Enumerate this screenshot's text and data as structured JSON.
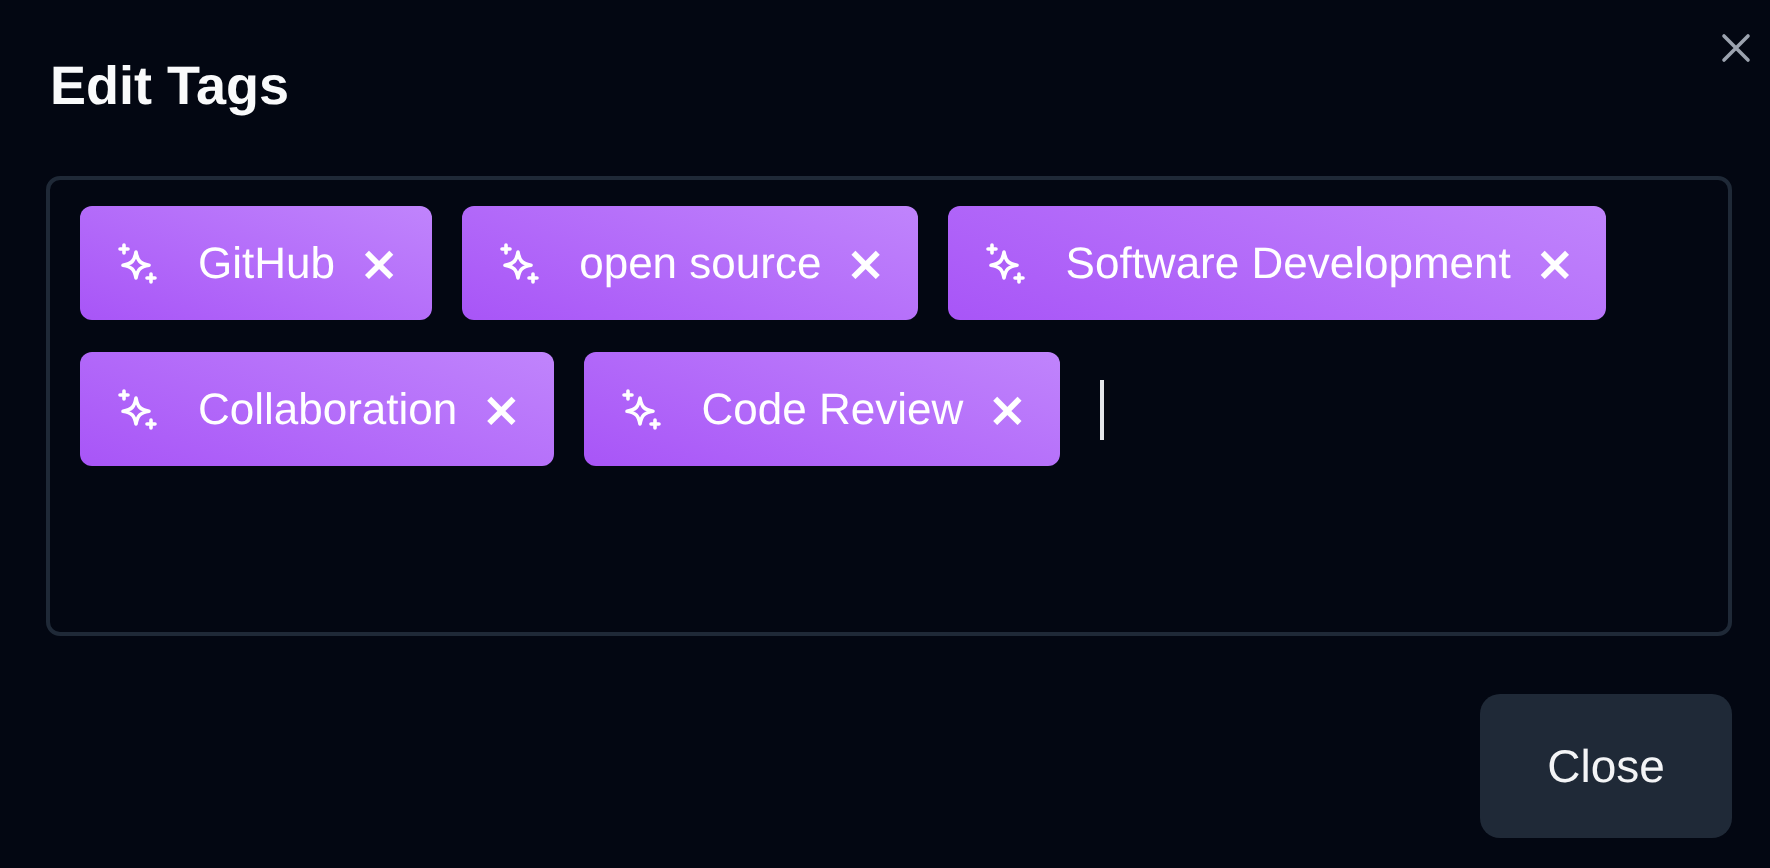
{
  "dialog": {
    "title": "Edit Tags"
  },
  "tags": [
    {
      "label": "GitHub",
      "remove": "×"
    },
    {
      "label": "open source",
      "remove": "×"
    },
    {
      "label": "Software Development",
      "remove": "×"
    },
    {
      "label": "Collaboration",
      "remove": "×"
    },
    {
      "label": "Code Review",
      "remove": "×"
    }
  ],
  "tag_input": {
    "focused": true
  },
  "buttons": [
    "Close"
  ]
}
